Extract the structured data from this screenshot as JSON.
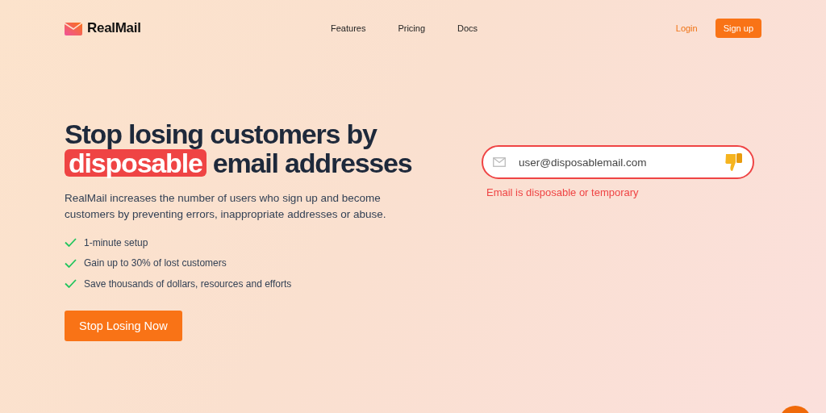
{
  "brand": {
    "name": "RealMail"
  },
  "nav": {
    "links": [
      "Features",
      "Pricing",
      "Docs"
    ],
    "login": "Login",
    "signup": "Sign up"
  },
  "hero": {
    "headline": {
      "before": "Stop losing customers by",
      "highlight": "disposable",
      "after": "email addresses"
    },
    "description": "RealMail increases the number of users who sign up and become customers by preventing errors, inappropriate addresses or abuse.",
    "features": [
      "1-minute setup",
      "Gain up to 30% of lost customers",
      "Save thousands of dollars, resources and efforts"
    ],
    "cta": "Stop Losing Now"
  },
  "demo": {
    "email_field": {
      "value": "user@disposablemail.com",
      "invalid": true
    },
    "error": "Email is disposable or temporary"
  }
}
